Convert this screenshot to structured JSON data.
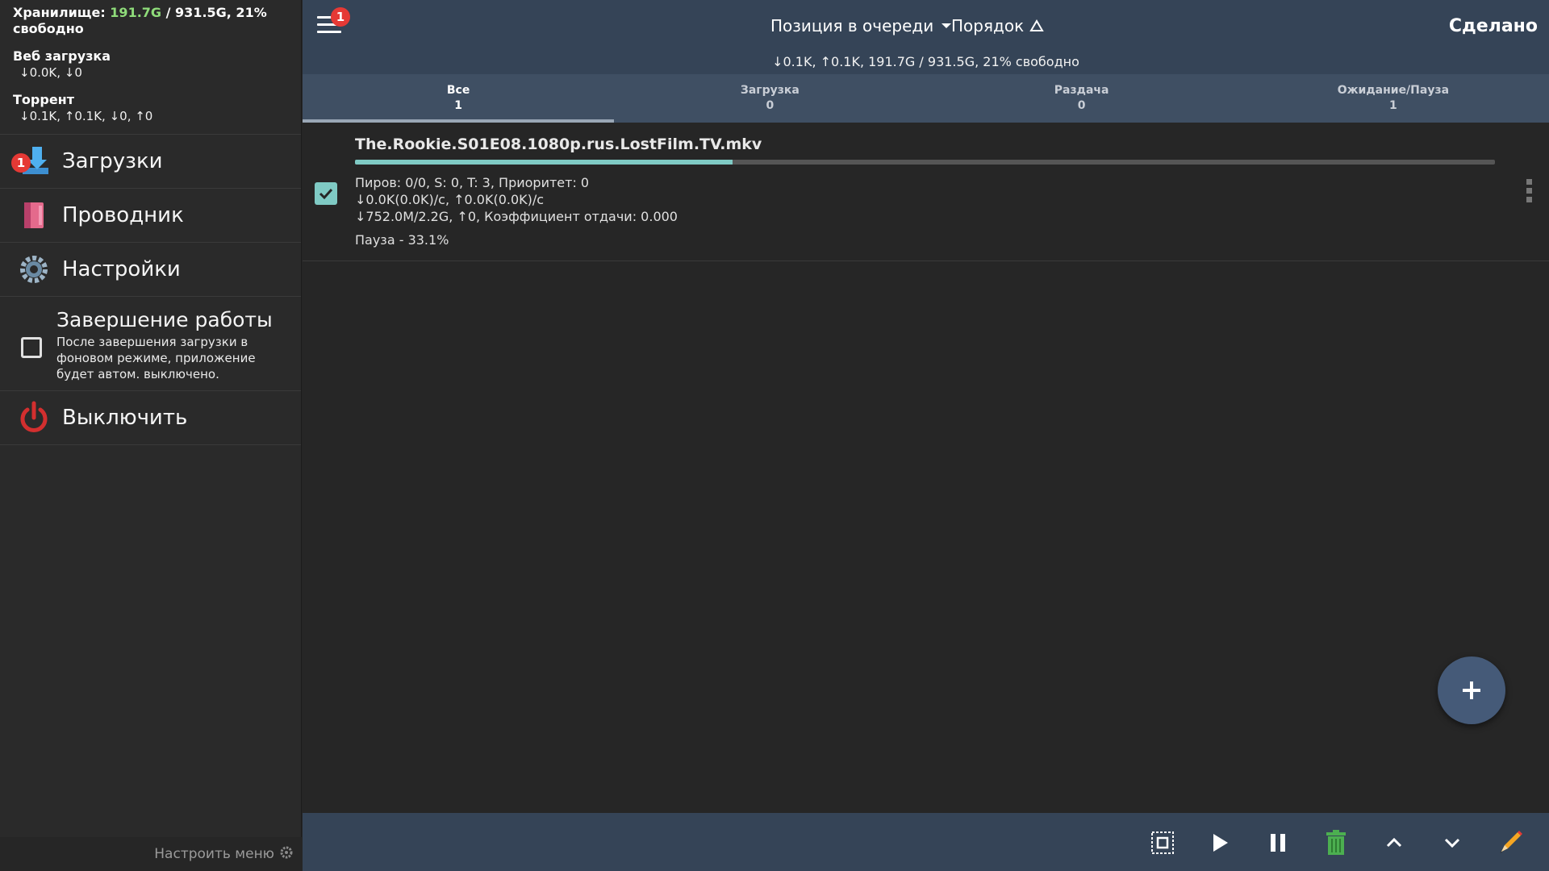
{
  "sidebar": {
    "storage_label": "Хранилище:",
    "storage_used": "191.7G",
    "storage_rest": "/ 931.5G, 21%",
    "storage_free": "свободно",
    "web_label": "Веб загрузка",
    "web_stats": "↓0.0K, ↓0",
    "torrent_label": "Торрент",
    "torrent_stats": "↓0.1K, ↑0.1K, ↓0, ↑0",
    "items": [
      {
        "label": "Загрузки",
        "icon": "downloads-icon",
        "badge": "1"
      },
      {
        "label": "Проводник",
        "icon": "explorer-icon"
      },
      {
        "label": "Настройки",
        "icon": "gear-icon"
      }
    ],
    "shutdown": {
      "title": "Завершение работы",
      "desc": "После завершения загрузки в фоновом режиме, приложение будет автом. выключено."
    },
    "power": {
      "label": "Выключить",
      "icon": "power-icon"
    },
    "footer": {
      "label": "Настроить меню",
      "icon": "gear-icon"
    }
  },
  "topbar": {
    "menu_badge": "1",
    "queue_position": "Позиция в очереди",
    "order": "Порядок",
    "done": "Сделано",
    "speed_line": "↓0.1K, ↑0.1K, 191.7G / 931.5G, 21% свободно"
  },
  "tabs": [
    {
      "label": "Все",
      "count": "1"
    },
    {
      "label": "Загрузка",
      "count": "0"
    },
    {
      "label": "Раздача",
      "count": "0"
    },
    {
      "label": "Ожидание/Пауза",
      "count": "1"
    }
  ],
  "torrent": {
    "name": "The.Rookie.S01E08.1080p.rus.LostFilm.TV.mkv",
    "progress": 0.331,
    "line1": "Пиров: 0/0, S: 0, T: 3, Приоритет: 0",
    "line2": "↓0.0K(0.0K)/с, ↑0.0K(0.0K)/с",
    "line3": "↓752.0M/2.2G, ↑0, Коэффициент отдачи: 0.000",
    "status": "Пауза - 33.1%"
  },
  "colors": {
    "accent": "#7fcac4",
    "toolbar": "#354457",
    "badge": "#e53935",
    "storage_green": "#8fdc7a"
  },
  "bottom_actions": [
    "select-all-icon",
    "play-icon",
    "pause-icon",
    "trash-icon",
    "chevron-up-icon",
    "chevron-down-icon",
    "pencil-icon"
  ]
}
